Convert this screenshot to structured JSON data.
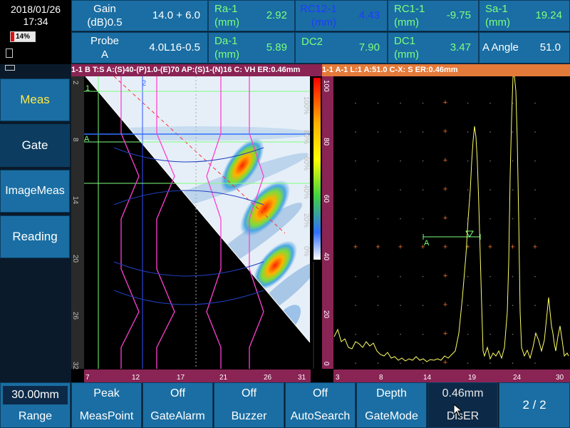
{
  "clock": {
    "date": "2018/01/26",
    "time": "17:34",
    "battery": "14%",
    "battery_level": 0.14
  },
  "params": [
    {
      "l1": "Gain",
      "l2": "(dB)0.5",
      "value": "14.0 + 6.0",
      "color": "#ffffff"
    },
    {
      "l1": "Ra-1",
      "l2": "(mm)",
      "value": "2.92",
      "color": "#7dff7d"
    },
    {
      "l1": "RC12-1",
      "l2": "(mm)",
      "value": "4.43",
      "color": "#1f3cff"
    },
    {
      "l1": "RC1-1",
      "l2": "(mm)",
      "value": "-9.75",
      "color": "#7dff7d"
    },
    {
      "l1": "Sa-1",
      "l2": "(mm)",
      "value": "19.24",
      "color": "#7dff7d"
    },
    {
      "l1": "Probe",
      "l2": "A",
      "value": "4.0L16-0.5",
      "color": "#ffffff"
    },
    {
      "l1": "Da-1",
      "l2": "(mm)",
      "value": "5.89",
      "color": "#7dff7d"
    },
    {
      "l1": "DC2",
      "l2": "",
      "value": "7.90",
      "color": "#7dff7d"
    },
    {
      "l1": "DC1",
      "l2": "(mm)",
      "value": "3.47",
      "color": "#7dff7d"
    },
    {
      "l1": "A Angle",
      "l2": "",
      "value": "51.0",
      "color": "#ffffff"
    }
  ],
  "sscan_header": "1-1 B  T:S A:(S)40-(P)1.0-(E)70  AP:(S)1-(N)16  C: VH     ER:0.46mm",
  "ascan_header": "1-1 A-1  L:1  A:51.0  C-X: S    ER:0.46mm",
  "menu": [
    "Meas",
    "Gate",
    "ImageMeas",
    "Reading"
  ],
  "sscan_axis": {
    "depth_ticks": [
      "2",
      "8",
      "14",
      "20",
      "26",
      "32"
    ],
    "x_ticks": [
      "7",
      "12",
      "17",
      "21",
      "26",
      "31"
    ],
    "colorbar_ticks": [
      "100%",
      "80%",
      "60%",
      "40%",
      "20%",
      "0%"
    ],
    "cursor_labels": [
      "1",
      "2",
      "A"
    ]
  },
  "ascan_axis": {
    "amp_ticks": [
      "100",
      "80",
      "60",
      "40",
      "20",
      "0"
    ],
    "x_ticks": [
      "3",
      "8",
      "14",
      "19",
      "24",
      "30"
    ],
    "gate_label": "A"
  },
  "bottom": [
    {
      "value": "30.00mm",
      "name": "Range"
    },
    {
      "value": "Peak",
      "name": "MeasPoint"
    },
    {
      "value": "Off",
      "name": "GateAlarm"
    },
    {
      "value": "Off",
      "name": "Buzzer"
    },
    {
      "value": "Off",
      "name": "AutoSearch"
    },
    {
      "value": "Depth",
      "name": "GateMode"
    },
    {
      "value": "0.46mm",
      "name": "DisER"
    }
  ],
  "page_indicator": "2 / 2",
  "colors": {
    "accent": "#1a6ea3",
    "header_left": "#8a2455",
    "header_right": "#e47a3a",
    "signal": "#ffff66",
    "gate": "#7dff7d"
  }
}
